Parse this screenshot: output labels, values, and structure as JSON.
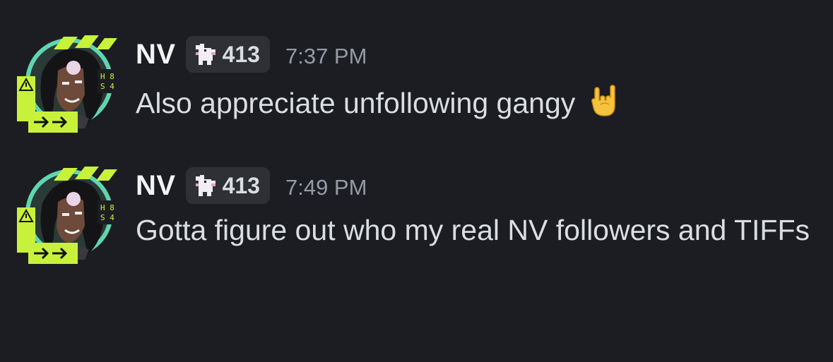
{
  "messages": [
    {
      "username": "NV",
      "tag_icon": "pixel-dog-icon",
      "tag_count": "413",
      "timestamp": "7:37 PM",
      "text": "Also appreciate unfollowing gangy",
      "emoji": "sign-of-the-horns-emoji"
    },
    {
      "username": "NV",
      "tag_icon": "pixel-dog-icon",
      "tag_count": "413",
      "timestamp": "7:49 PM",
      "text": "Gotta figure out who my real NV followers and TIFFs"
    }
  ],
  "colors": {
    "background": "#1c1d22",
    "username": "#f2f3f5",
    "text": "#dbdee1",
    "timestamp": "#949ba4",
    "tag_background": "#2e3036",
    "avatar_accent": "#c8f23a",
    "avatar_circle": "#5fd6b0"
  }
}
